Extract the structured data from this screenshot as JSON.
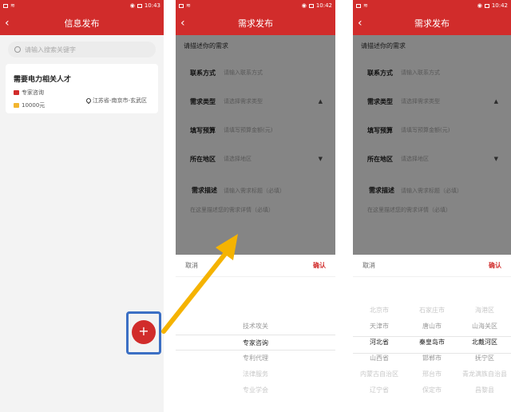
{
  "status": {
    "time1": "10:43",
    "time2": "10:42",
    "time3": "10:42"
  },
  "screen1": {
    "title": "信息发布",
    "search_placeholder": "请输入搜索关键字",
    "card": {
      "title": "需要电力相关人才",
      "type": "专家咨询",
      "budget": "10000元",
      "location": "江苏省-南京市-玄武区"
    },
    "fab_label": "+"
  },
  "form": {
    "title": "需求发布",
    "heading": "请描述你的需求",
    "rows": [
      {
        "label": "联系方式",
        "placeholder": "请输入联系方式",
        "arrow": ""
      },
      {
        "label": "需求类型",
        "placeholder": "请选择需求类型",
        "arrow": "▲"
      },
      {
        "label": "填写预算",
        "placeholder": "请填写预算金额(元)",
        "arrow": ""
      },
      {
        "label": "所在地区",
        "placeholder": "请选择地区",
        "arrow": "▼"
      }
    ],
    "desc_label": "需求描述",
    "desc_title_placeholder": "请输入需求标题（必填）",
    "desc_body_placeholder": "在这里描述您的需求详情（必填）"
  },
  "picker": {
    "cancel": "取消",
    "confirm": "确认"
  },
  "type_picker": {
    "items": [
      "技术攻关",
      "专家咨询",
      "专利代理",
      "法律服务",
      "专业学会"
    ],
    "selected_index": 1
  },
  "region_picker": {
    "provinces": [
      "北京市",
      "天津市",
      "河北省",
      "山西省",
      "内蒙古自治区",
      "辽宁省"
    ],
    "cities": [
      "石家庄市",
      "唐山市",
      "秦皇岛市",
      "邯郸市",
      "邢台市",
      "保定市"
    ],
    "districts": [
      "海港区",
      "山海关区",
      "北戴河区",
      "抚宁区",
      "青龙满族自治县",
      "昌黎县"
    ],
    "selected_index": 2
  },
  "colors": {
    "brand_red": "#d12c2b",
    "highlight_blue": "#3b6fc4",
    "arrow_yellow": "#f5b301"
  }
}
